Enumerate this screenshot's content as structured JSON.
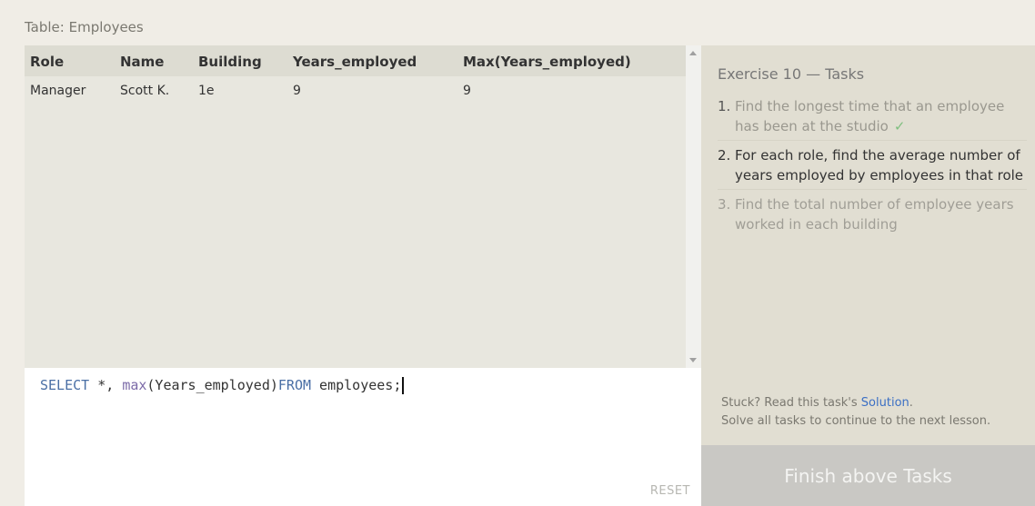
{
  "table_title": "Table: Employees",
  "results": {
    "headers": [
      "Role",
      "Name",
      "Building",
      "Years_employed",
      "Max(Years_employed)"
    ],
    "rows": [
      [
        "Manager",
        "Scott K.",
        "1e",
        "9",
        "9"
      ]
    ]
  },
  "editor": {
    "tokens": {
      "select": "SELECT",
      "star": " *, ",
      "max": "max",
      "arg": "(Years_employed)",
      "from": "FROM",
      "table": " employees;"
    },
    "reset_label": "RESET"
  },
  "tasks": {
    "title": "Exercise 10 — Tasks",
    "items": [
      {
        "num": "1.",
        "text": "Find the longest time that an employee has been at the studio",
        "check": "✓"
      },
      {
        "num": "2.",
        "text": "For each role, find the average number of years employed by employees in that role"
      },
      {
        "num": "3.",
        "text": "Find the total number of employee years worked in each building"
      }
    ],
    "hint_prefix": "Stuck? Read this task's ",
    "hint_link": "Solution",
    "hint_suffix": ".",
    "hint_line2": "Solve all tasks to continue to the next lesson."
  },
  "finish_label": "Finish above Tasks"
}
